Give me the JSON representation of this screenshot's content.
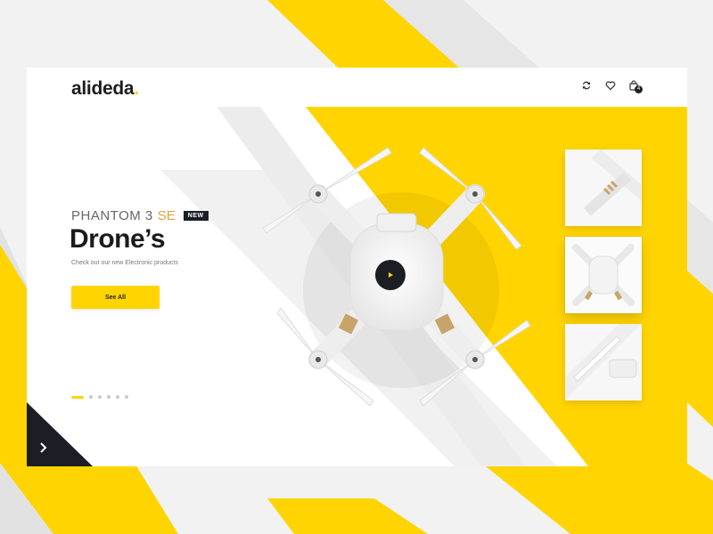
{
  "brand": {
    "name": "alideda",
    "dot": ".",
    "accent": "#ffd400",
    "dark": "#1b1e24"
  },
  "header": {
    "icons": [
      "compare-icon",
      "heart-icon",
      "cart-icon"
    ],
    "cart_count": "4"
  },
  "hero": {
    "product_name": "PHANTOM 3",
    "product_suffix": "SE",
    "badge": "NEW",
    "headline": "Drone’s",
    "subtitle": "Check out our new Electronic products",
    "cta_label": "See All"
  },
  "slider": {
    "total": 6,
    "active": 1
  },
  "thumbnails": [
    "drone-arm-closeup",
    "drone-top-view",
    "drone-propeller-view"
  ],
  "thumbnail_active": 2
}
